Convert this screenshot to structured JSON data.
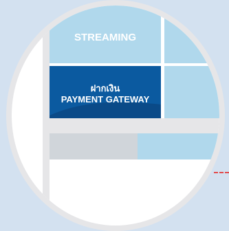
{
  "tiles": {
    "streaming": {
      "label": "STREAMING"
    },
    "payment": {
      "label_th": "ฝากเงิน",
      "label_en": "PAYMENT GATEWAY"
    }
  },
  "colors": {
    "page_bg": "#d3e1f0",
    "light_tile": "#b0d8ec",
    "dark_tile": "#0b5aa0",
    "gray_bar": "#d0d5da",
    "frame": "#e6e6e8",
    "dash": "#e24b4b"
  }
}
